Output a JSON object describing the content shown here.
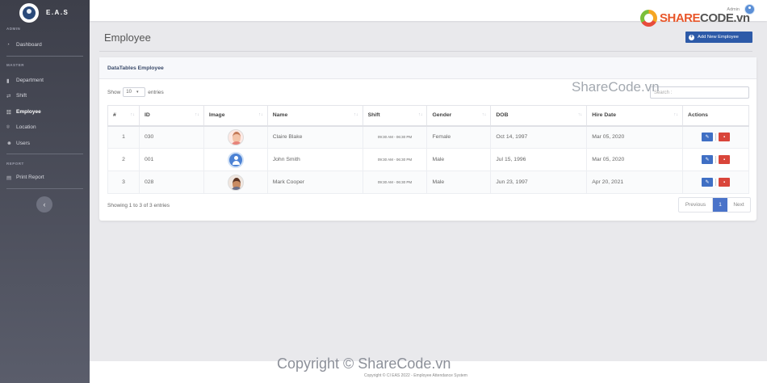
{
  "brand": {
    "name": "E.A.S"
  },
  "sidebar": {
    "section_admin": "ADMIN",
    "section_master": "MASTER",
    "section_report": "REPORT",
    "items": [
      {
        "label": "Dashboard",
        "icon": "dashboard-icon"
      },
      {
        "label": "Department",
        "icon": "building-icon"
      },
      {
        "label": "Shift",
        "icon": "exchange-icon"
      },
      {
        "label": "Employee",
        "icon": "user-tie-icon"
      },
      {
        "label": "Location",
        "icon": "map-marker-icon"
      },
      {
        "label": "Users",
        "icon": "users-icon"
      },
      {
        "label": "Print Report",
        "icon": "file-icon"
      }
    ],
    "toggle_glyph": "‹"
  },
  "topbar": {
    "user": "Admin"
  },
  "watermark": {
    "logo_a": "SHARE",
    "logo_b": "CODE.vn",
    "search_overlay": "ShareCode.vn",
    "copyright": "Copyright © ShareCode.vn"
  },
  "page": {
    "title": "Employee",
    "add_button": "Add New Employee"
  },
  "card": {
    "title": "DataTables Employee",
    "show_label": "Show",
    "entries_value": "10",
    "entries_label": "entries",
    "search_label": "Search :"
  },
  "table": {
    "headers": [
      "#",
      "ID",
      "Image",
      "Name",
      "Shift",
      "Gender",
      "DOB",
      "Hire Date",
      "Actions"
    ],
    "rows": [
      {
        "no": "1",
        "id": "030",
        "name": "Claire Blake",
        "shift": "09:30 AM - 06:30 PM",
        "gender": "Female",
        "dob": "Oct 14, 1997",
        "hire": "Mar 05, 2020"
      },
      {
        "no": "2",
        "id": "001",
        "name": "John Smith",
        "shift": "09:30 AM - 06:30 PM",
        "gender": "Male",
        "dob": "Jul 15, 1996",
        "hire": "Mar 05, 2020"
      },
      {
        "no": "3",
        "id": "028",
        "name": "Mark Cooper",
        "shift": "09:30 AM - 06:30 PM",
        "gender": "Male",
        "dob": "Jun 23, 1997",
        "hire": "Apr 20, 2021"
      }
    ],
    "info": "Showing 1 to 3 of 3 entries"
  },
  "pager": {
    "prev": "Previous",
    "current": "1",
    "next": "Next"
  },
  "footer": {
    "text": "Copyright © CI EAS 2022 - Employee Attendance System"
  }
}
